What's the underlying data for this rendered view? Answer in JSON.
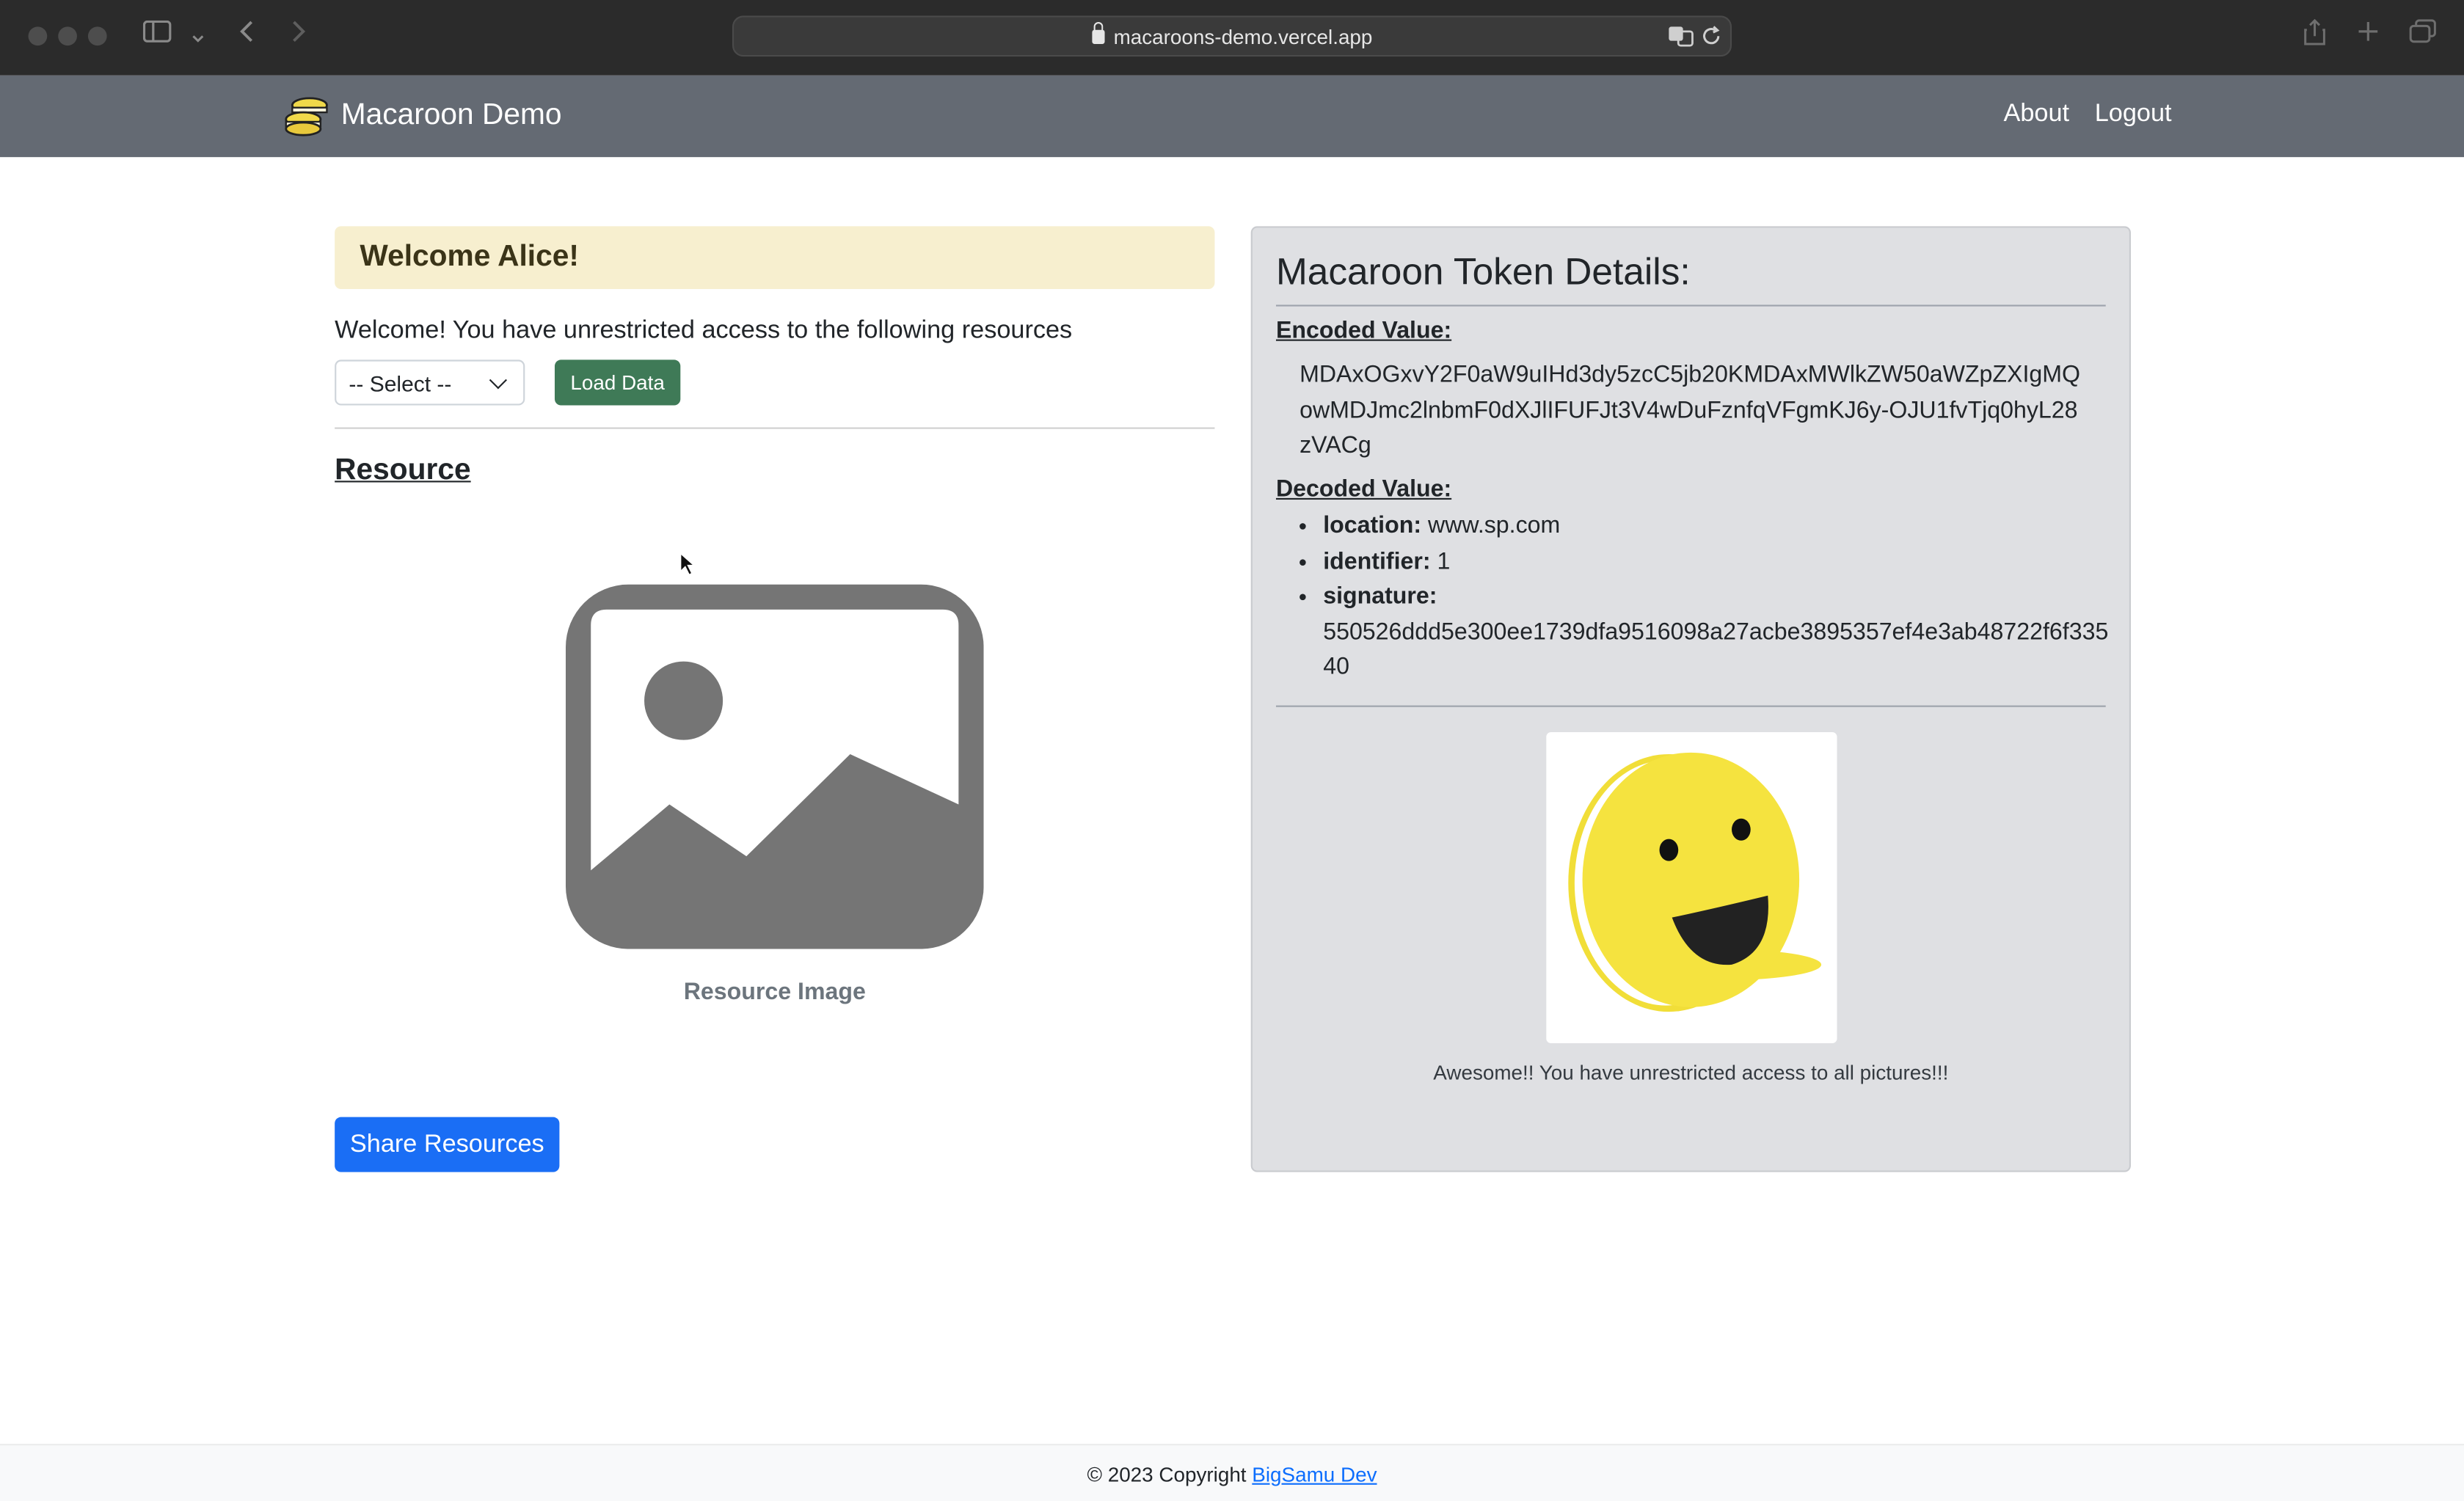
{
  "browser": {
    "url": "macaroons-demo.vercel.app"
  },
  "navbar": {
    "brand": "Macaroon Demo",
    "links": [
      "About",
      "Logout"
    ]
  },
  "left": {
    "welcome_heading": "Welcome Alice!",
    "intro_text": "Welcome! You have unrestricted access to the following resources",
    "select_value": "-- Select --",
    "load_button": "Load Data",
    "resource_title": "Resource",
    "resource_caption": "Resource Image",
    "share_button": "Share Resources"
  },
  "token": {
    "title": "Macaroon Token Details:",
    "encoded_label": "Encoded Value:",
    "encoded_value": "MDAxOGxvY2F0aW9uIHd3dy5zcC5jb20KMDAxMWlkZW50aWZpZXIgMQowMDJmc2lnbmF0dXJlIFUFJt3V4wDuFznfqVFgmKJ6y-OJU1fvTjq0hyL28zVACg",
    "decoded_label": "Decoded Value:",
    "location_label": "location:",
    "location_value": "www.sp.com",
    "identifier_label": "identifier:",
    "identifier_value": "1",
    "signature_label": "signature:",
    "signature_value": "550526ddd5e300ee1739dfa9516098a27acbe3895357ef4e3ab48722f6f33540",
    "caption": "Awesome!! You have unrestricted access to all pictures!!!"
  },
  "footer": {
    "copyright": "© 2023 Copyright",
    "link": "BigSamu Dev"
  },
  "colors": {
    "navbar": "#646a73",
    "alert_bg": "#f7efcf",
    "load_button": "#3f7a57",
    "share_button": "#1a6ef5",
    "panel_bg": "#dfe0e3",
    "smiley": "#f5e33f"
  }
}
